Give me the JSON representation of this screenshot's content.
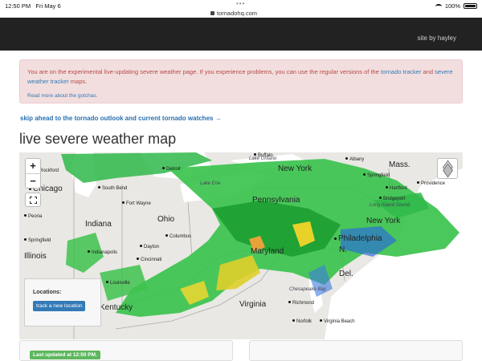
{
  "status_bar": {
    "time": "12:50 PM",
    "date": "Fri May 6",
    "url": "tornadohq.com",
    "battery": "100%"
  },
  "header": {
    "credit": "site by hayley"
  },
  "alert": {
    "text_1": "You are on the experimental live-updating severe weather page. If you experience problems, you can use the regular versions of the ",
    "link_1": "tornado tracker",
    "text_2": " and ",
    "link_2": "severe weather tracker",
    "text_3": " maps.",
    "more_link": "Read more about the gotchas."
  },
  "skip_link": "skip ahead to the tornado outlook and current tornado watches →",
  "page_title": "live severe weather map",
  "map": {
    "zoom_in": "+",
    "zoom_out": "−",
    "states": [
      "Indiana",
      "Ohio",
      "Illinois",
      "Kentucky",
      "Virginia",
      "Pennsylvania",
      "New York",
      "Maryland",
      "Del.",
      "Mass.",
      "N."
    ],
    "cities": [
      "Buffalo",
      "Detroit",
      "Rockford",
      "Chicago",
      "South Bend",
      "Fort Wayne",
      "Peoria",
      "Springfield",
      "Indianapolis",
      "Dayton",
      "Columbus",
      "Cincinnati",
      "Louisville",
      "Albany",
      "Springfield",
      "Hartford",
      "Providence",
      "Bridgeport",
      "New York",
      "Philadelphia",
      "Richmond",
      "Norfolk",
      "Virginia Beach",
      "Chesapeake Bay",
      "Long Island Sound",
      "Lake Ontario",
      "Lake Erie"
    ],
    "locations_label": "Locations:",
    "track_button": "track a new location"
  },
  "last_updated": "Last updated at 12:50 PM."
}
